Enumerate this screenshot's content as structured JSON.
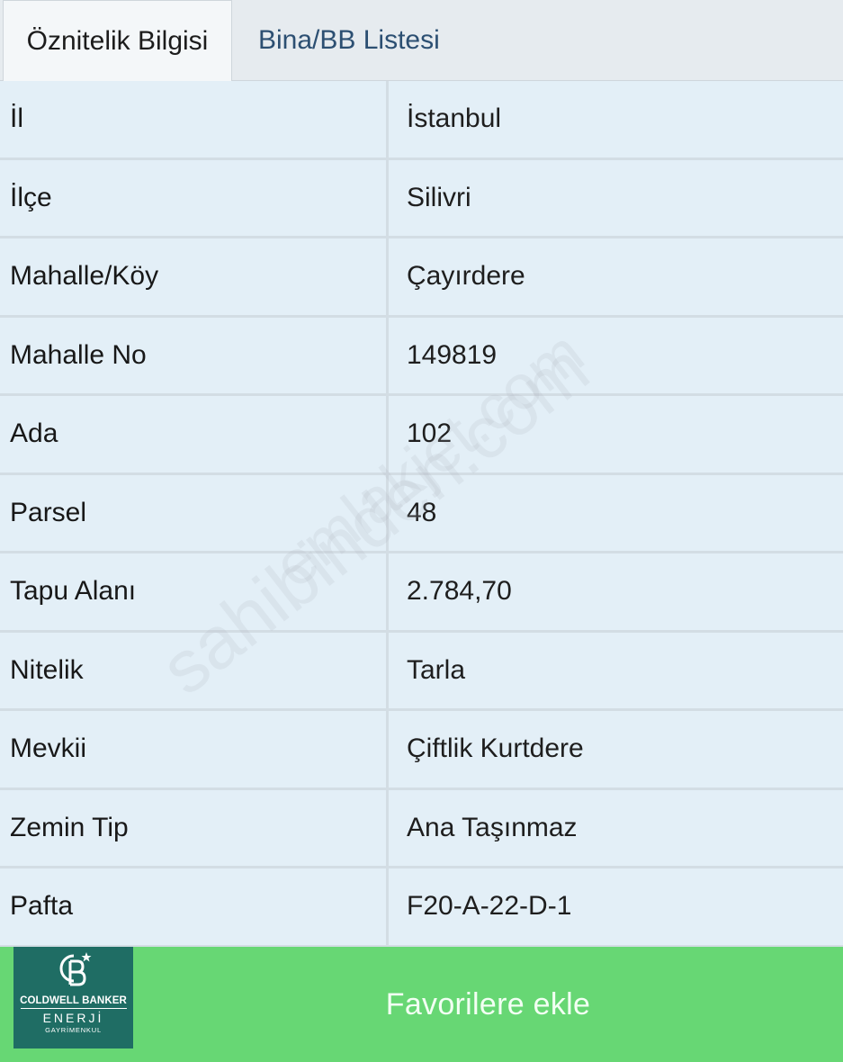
{
  "tabs": [
    {
      "label": "Öznitelik Bilgisi",
      "active": true
    },
    {
      "label": "Bina/BB Listesi",
      "active": false
    }
  ],
  "rows": [
    {
      "key": "İl",
      "value": "İstanbul"
    },
    {
      "key": "İlçe",
      "value": "Silivri"
    },
    {
      "key": "Mahalle/Köy",
      "value": "Çayırdere"
    },
    {
      "key": "Mahalle No",
      "value": "149819"
    },
    {
      "key": "Ada",
      "value": "102"
    },
    {
      "key": "Parsel",
      "value": "48"
    },
    {
      "key": "Tapu Alanı",
      "value": "2.784,70"
    },
    {
      "key": "Nitelik",
      "value": "Tarla"
    },
    {
      "key": "Mevkii",
      "value": "Çiftlik Kurtdere"
    },
    {
      "key": "Zemin Tip",
      "value": "Ana Taşınmaz"
    },
    {
      "key": "Pafta",
      "value": "F20-A-22-D-1"
    }
  ],
  "favorite_button": {
    "label": "Favorilere ekle"
  },
  "logo": {
    "mark": "CB",
    "brand": "COLDWELL BANKER",
    "subtitle": "ENERJİ",
    "subtitle2": "GAYRİMENKUL"
  },
  "watermark": {
    "line1": "sahibinden.com",
    "line2": "emlakjet.com"
  },
  "colors": {
    "button_green": "#67d774",
    "logo_teal": "#1f6d64",
    "table_bg": "#e3eff7",
    "inactive_tab_text": "#2c4f72"
  }
}
